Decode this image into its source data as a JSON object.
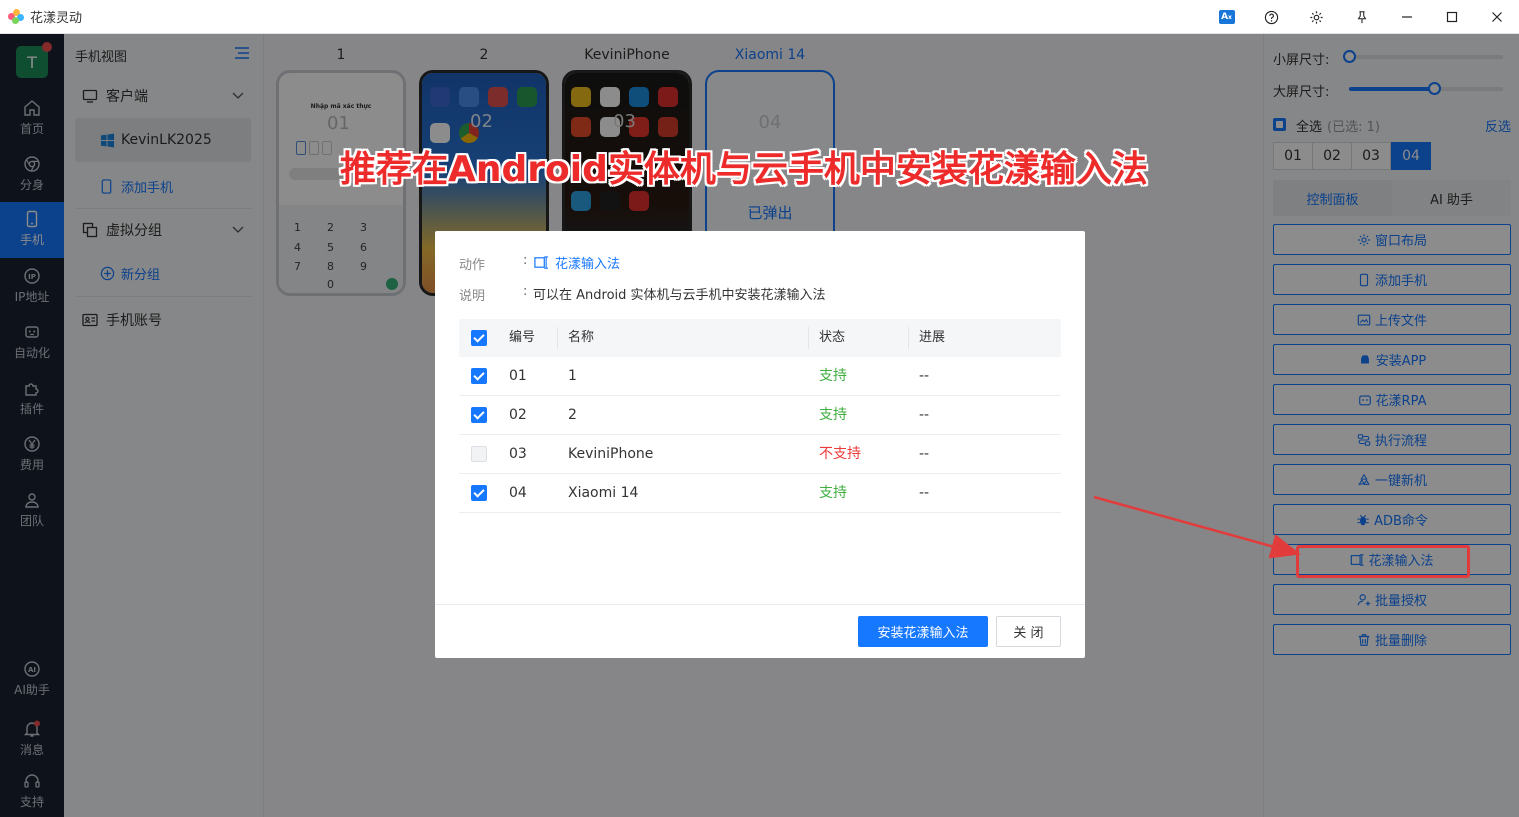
{
  "app": {
    "title": "花漾灵动"
  },
  "leftnav": {
    "avatar_letter": "T",
    "items": [
      {
        "label": "首页",
        "icon": "home-icon"
      },
      {
        "label": "分身",
        "icon": "chrome-icon"
      },
      {
        "label": "手机",
        "icon": "phone-icon"
      },
      {
        "label": "IP地址",
        "icon": "ip-icon"
      },
      {
        "label": "自动化",
        "icon": "robot-icon"
      },
      {
        "label": "插件",
        "icon": "puzzle-icon"
      },
      {
        "label": "费用",
        "icon": "yen-icon"
      },
      {
        "label": "团队",
        "icon": "team-icon"
      },
      {
        "label": "AI助手",
        "icon": "ai-icon"
      },
      {
        "label": "消息",
        "icon": "bell-icon"
      },
      {
        "label": "支持",
        "icon": "headset-icon"
      }
    ]
  },
  "tree": {
    "header": "手机视图",
    "client_group": "客户端",
    "client_name": "KevinLK2025",
    "add_phone": "添加手机",
    "virtual_group": "虚拟分组",
    "new_group": "新分组",
    "phone_accounts": "手机账号"
  },
  "phones": [
    {
      "label": "1",
      "keypad_title": "Nhập mã xác thực",
      "keys": [
        "1",
        "2",
        "3",
        "4",
        "5",
        "6",
        "7",
        "8",
        "9",
        "0"
      ],
      "number_overlay": "01"
    },
    {
      "label": "2",
      "number_overlay": "02"
    },
    {
      "label": "KeviniPhone",
      "number_overlay": "03"
    },
    {
      "label": "Xiaomi 14",
      "number_overlay": "04",
      "status": "已弹出"
    }
  ],
  "banner": "推荐在Android实体机与云手机中安装花漾输入法",
  "rightpanel": {
    "small_size_label": "小屏尺寸:",
    "large_size_label": "大屏尺寸:",
    "small_size_level": 0,
    "large_size_level": 0.55,
    "select_all": "全选",
    "selected_count": "(已选: 1)",
    "invert": "反选",
    "segments": [
      "01",
      "02",
      "03",
      "04"
    ],
    "tabs": [
      "控制面板",
      "AI 助手"
    ],
    "buttons": [
      "窗口布局",
      "添加手机",
      "上传文件",
      "安装APP",
      "花漾RPA",
      "执行流程",
      "一键新机",
      "ADB命令",
      "花漾输入法",
      "批量授权",
      "批量删除"
    ]
  },
  "modal": {
    "action_key": "动作",
    "action_value": "花漾输入法",
    "desc_key": "说明",
    "colon": ":",
    "desc_value": "可以在 Android 实体机与云手机中安装花漾输入法",
    "columns": [
      "编号",
      "名称",
      "状态",
      "进展"
    ],
    "rows": [
      {
        "id": "01",
        "name": "1",
        "status": "支持",
        "progress": "--",
        "checked": true
      },
      {
        "id": "02",
        "name": "2",
        "status": "支持",
        "progress": "--",
        "checked": true
      },
      {
        "id": "03",
        "name": "KeviniPhone",
        "status": "不支持",
        "progress": "--",
        "checked": false
      },
      {
        "id": "04",
        "name": "Xiaomi 14",
        "status": "支持",
        "progress": "--",
        "checked": true
      }
    ],
    "install_button": "安装花漾输入法",
    "close_button": "关 闭"
  },
  "colors": {
    "accent": "#1677ff",
    "nav_bg": "#1a2230",
    "ok": "#3fae3f",
    "bad": "#ee3b3b",
    "annotation": "#e23b3b"
  }
}
